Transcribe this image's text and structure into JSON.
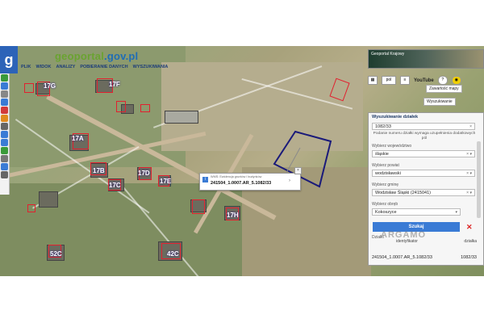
{
  "header": {
    "logo_letter": "g",
    "brand_prefix": "geoportal",
    "brand_suffix": ".gov.pl",
    "menu": [
      "PLIK",
      "WIDOK",
      "ANALIZY",
      "POBIERANIE DANYCH",
      "WYSZUKIWANIA"
    ]
  },
  "top_right": {
    "strip_label": "Geoportal Krajowy",
    "lang": "pol",
    "youtube_label": "YouTube",
    "zawartosc_label": "Zawartość mapy",
    "wyszukiwanie_label": "Wyszukiwanie"
  },
  "search_panel": {
    "title": "Wyszukiwanie działek",
    "query": "1082/33",
    "note": "Podanie numeru działki wymaga uzupełnienia dodatkowych pól",
    "wojewodztwo_label": "Wybierz województwo",
    "wojewodztwo_value": "śląskie",
    "powiat_label": "Wybierz powiat",
    "powiat_value": "wodzisławski",
    "gmina_label": "Wybierz gminę",
    "gmina_value": "Wodzisław Śląski (2415041)",
    "obreb_label": "Wybierz obręb",
    "obreb_value": "Kokoszyce",
    "szukaj_label": "Szukaj",
    "results_label": "Działki",
    "col_id": "identyfikator",
    "col_dzialka": "działka",
    "result_id": "241504_1.0007.AR_5.1082/33",
    "result_dzialka": "1082/33"
  },
  "popup": {
    "title": "WMS: Ewidencja gruntów i budynków",
    "value": "241504_1.0007.AR_5.1082/33"
  },
  "watermark": "ARGAMO",
  "map_labels": [
    "17F",
    "17G",
    "17A",
    "17B",
    "17C",
    "17D",
    "17E",
    "17H",
    "52C",
    "42C"
  ]
}
